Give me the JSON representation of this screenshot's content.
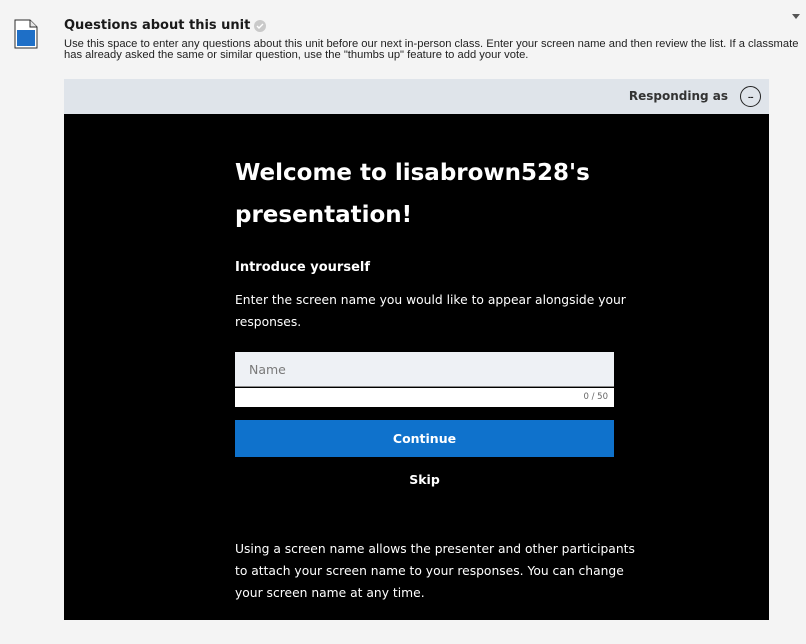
{
  "activity": {
    "title": "Questions about this unit",
    "description": "Use this space to enter any questions about this unit before our next in-person class. Enter your screen name and then review the list. If a classmate has already asked the same or similar question, use the \"thumbs up\" feature to add your vote."
  },
  "responding_bar": {
    "label": "Responding as",
    "avatar_text": "--"
  },
  "presentation": {
    "welcome_title": "Welcome to lisabrown528's presentation!",
    "intro_heading": "Introduce yourself",
    "intro_text": "Enter the screen name you would like to appear alongside your responses.",
    "name_field": {
      "placeholder": "Name",
      "value": "",
      "counter": "0 / 50"
    },
    "continue_label": "Continue",
    "skip_label": "Skip",
    "footnote": "Using a screen name allows the presenter and other participants to attach your screen name to your responses. You can change your screen name at any time."
  },
  "colors": {
    "accent": "#0f72cc",
    "panel_bg": "#000000",
    "respond_bar_bg": "#dfe4ea"
  }
}
